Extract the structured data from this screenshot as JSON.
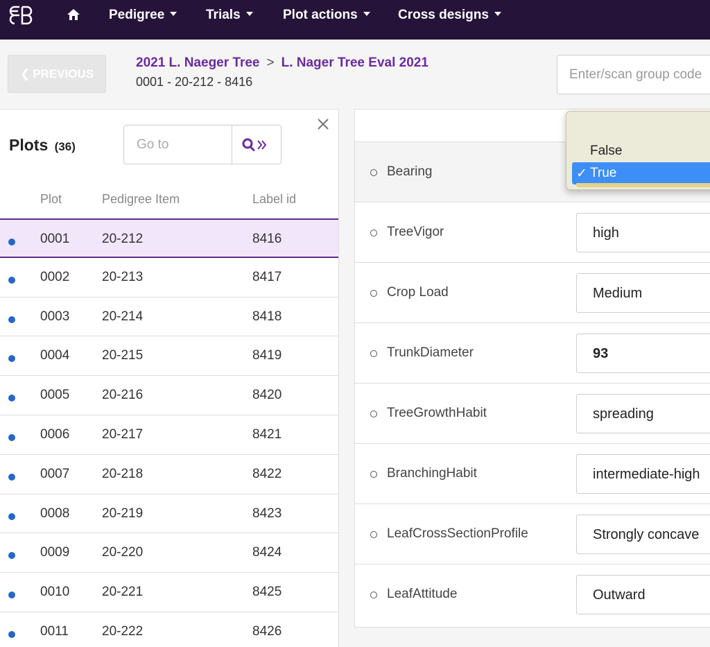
{
  "nav": {
    "items": [
      {
        "label": "Pedigree"
      },
      {
        "label": "Trials"
      },
      {
        "label": "Plot actions"
      },
      {
        "label": "Cross designs"
      }
    ]
  },
  "header": {
    "previous_label": "PREVIOUS",
    "breadcrumb": [
      "2021 L. Naeger Tree",
      "L. Nager Tree Eval 2021"
    ],
    "breadcrumb_sep": ">",
    "plot_id": "0001 - 20-212 - 8416",
    "group_code_placeholder": "Enter/scan group code"
  },
  "plots": {
    "title": "Plots",
    "count": "(36)",
    "goto_placeholder": "Go to",
    "columns": [
      "Plot",
      "Pedigree Item",
      "Label id"
    ],
    "rows": [
      {
        "plot": "0001",
        "pedigree": "20-212",
        "label": "8416"
      },
      {
        "plot": "0002",
        "pedigree": "20-213",
        "label": "8417"
      },
      {
        "plot": "0003",
        "pedigree": "20-214",
        "label": "8418"
      },
      {
        "plot": "0004",
        "pedigree": "20-215",
        "label": "8419"
      },
      {
        "plot": "0005",
        "pedigree": "20-216",
        "label": "8420"
      },
      {
        "plot": "0006",
        "pedigree": "20-217",
        "label": "8421"
      },
      {
        "plot": "0007",
        "pedigree": "20-218",
        "label": "8422"
      },
      {
        "plot": "0008",
        "pedigree": "20-219",
        "label": "8423"
      },
      {
        "plot": "0009",
        "pedigree": "20-220",
        "label": "8424"
      },
      {
        "plot": "0010",
        "pedigree": "20-221",
        "label": "8425"
      },
      {
        "plot": "0011",
        "pedigree": "20-222",
        "label": "8426"
      }
    ]
  },
  "traits": [
    {
      "name": "Bearing",
      "value": ""
    },
    {
      "name": "TreeVigor",
      "value": "high"
    },
    {
      "name": "Crop Load",
      "value": "Medium"
    },
    {
      "name": "TrunkDiameter",
      "value": "93"
    },
    {
      "name": "TreeGrowthHabit",
      "value": "spreading"
    },
    {
      "name": "BranchingHabit",
      "value": "intermediate-high"
    },
    {
      "name": "LeafCrossSectionProfile",
      "value": "Strongly concave"
    },
    {
      "name": "LeafAttitude",
      "value": "Outward"
    }
  ],
  "dropdown": {
    "options": [
      "False",
      "True"
    ],
    "selected": "True",
    "check": "✓"
  },
  "colors": {
    "nav_bg": "#251339",
    "accent": "#6b2a9e",
    "selection": "#3e8ef7",
    "dot": "#2766c6"
  }
}
